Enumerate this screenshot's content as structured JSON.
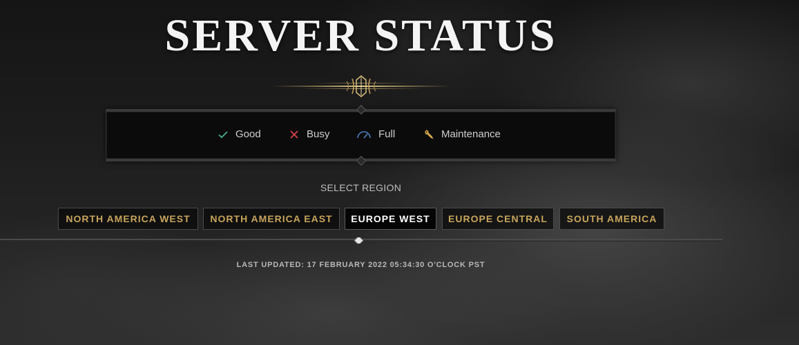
{
  "page": {
    "title": "SERVER STATUS"
  },
  "legend": {
    "items": [
      {
        "label": "Good",
        "icon": "check-icon",
        "color": "#4caf83"
      },
      {
        "label": "Busy",
        "icon": "x-icon",
        "color": "#d9434a"
      },
      {
        "label": "Full",
        "icon": "gauge-icon",
        "color": "#4a7fbf"
      },
      {
        "label": "Maintenance",
        "icon": "wrench-icon",
        "color": "#d4a94a"
      }
    ]
  },
  "region_selector": {
    "label": "SELECT REGION",
    "regions": [
      {
        "label": "NORTH AMERICA WEST",
        "selected": false
      },
      {
        "label": "NORTH AMERICA EAST",
        "selected": false
      },
      {
        "label": "EUROPE WEST",
        "selected": true
      },
      {
        "label": "EUROPE CENTRAL",
        "selected": false
      },
      {
        "label": "SOUTH AMERICA",
        "selected": false
      }
    ]
  },
  "status": {
    "last_updated": "LAST UPDATED: 17 FEBRUARY 2022 05:34:30 O'CLOCK PST"
  },
  "colors": {
    "accent_gold": "#c8a55c",
    "active_text": "#ffffff"
  }
}
